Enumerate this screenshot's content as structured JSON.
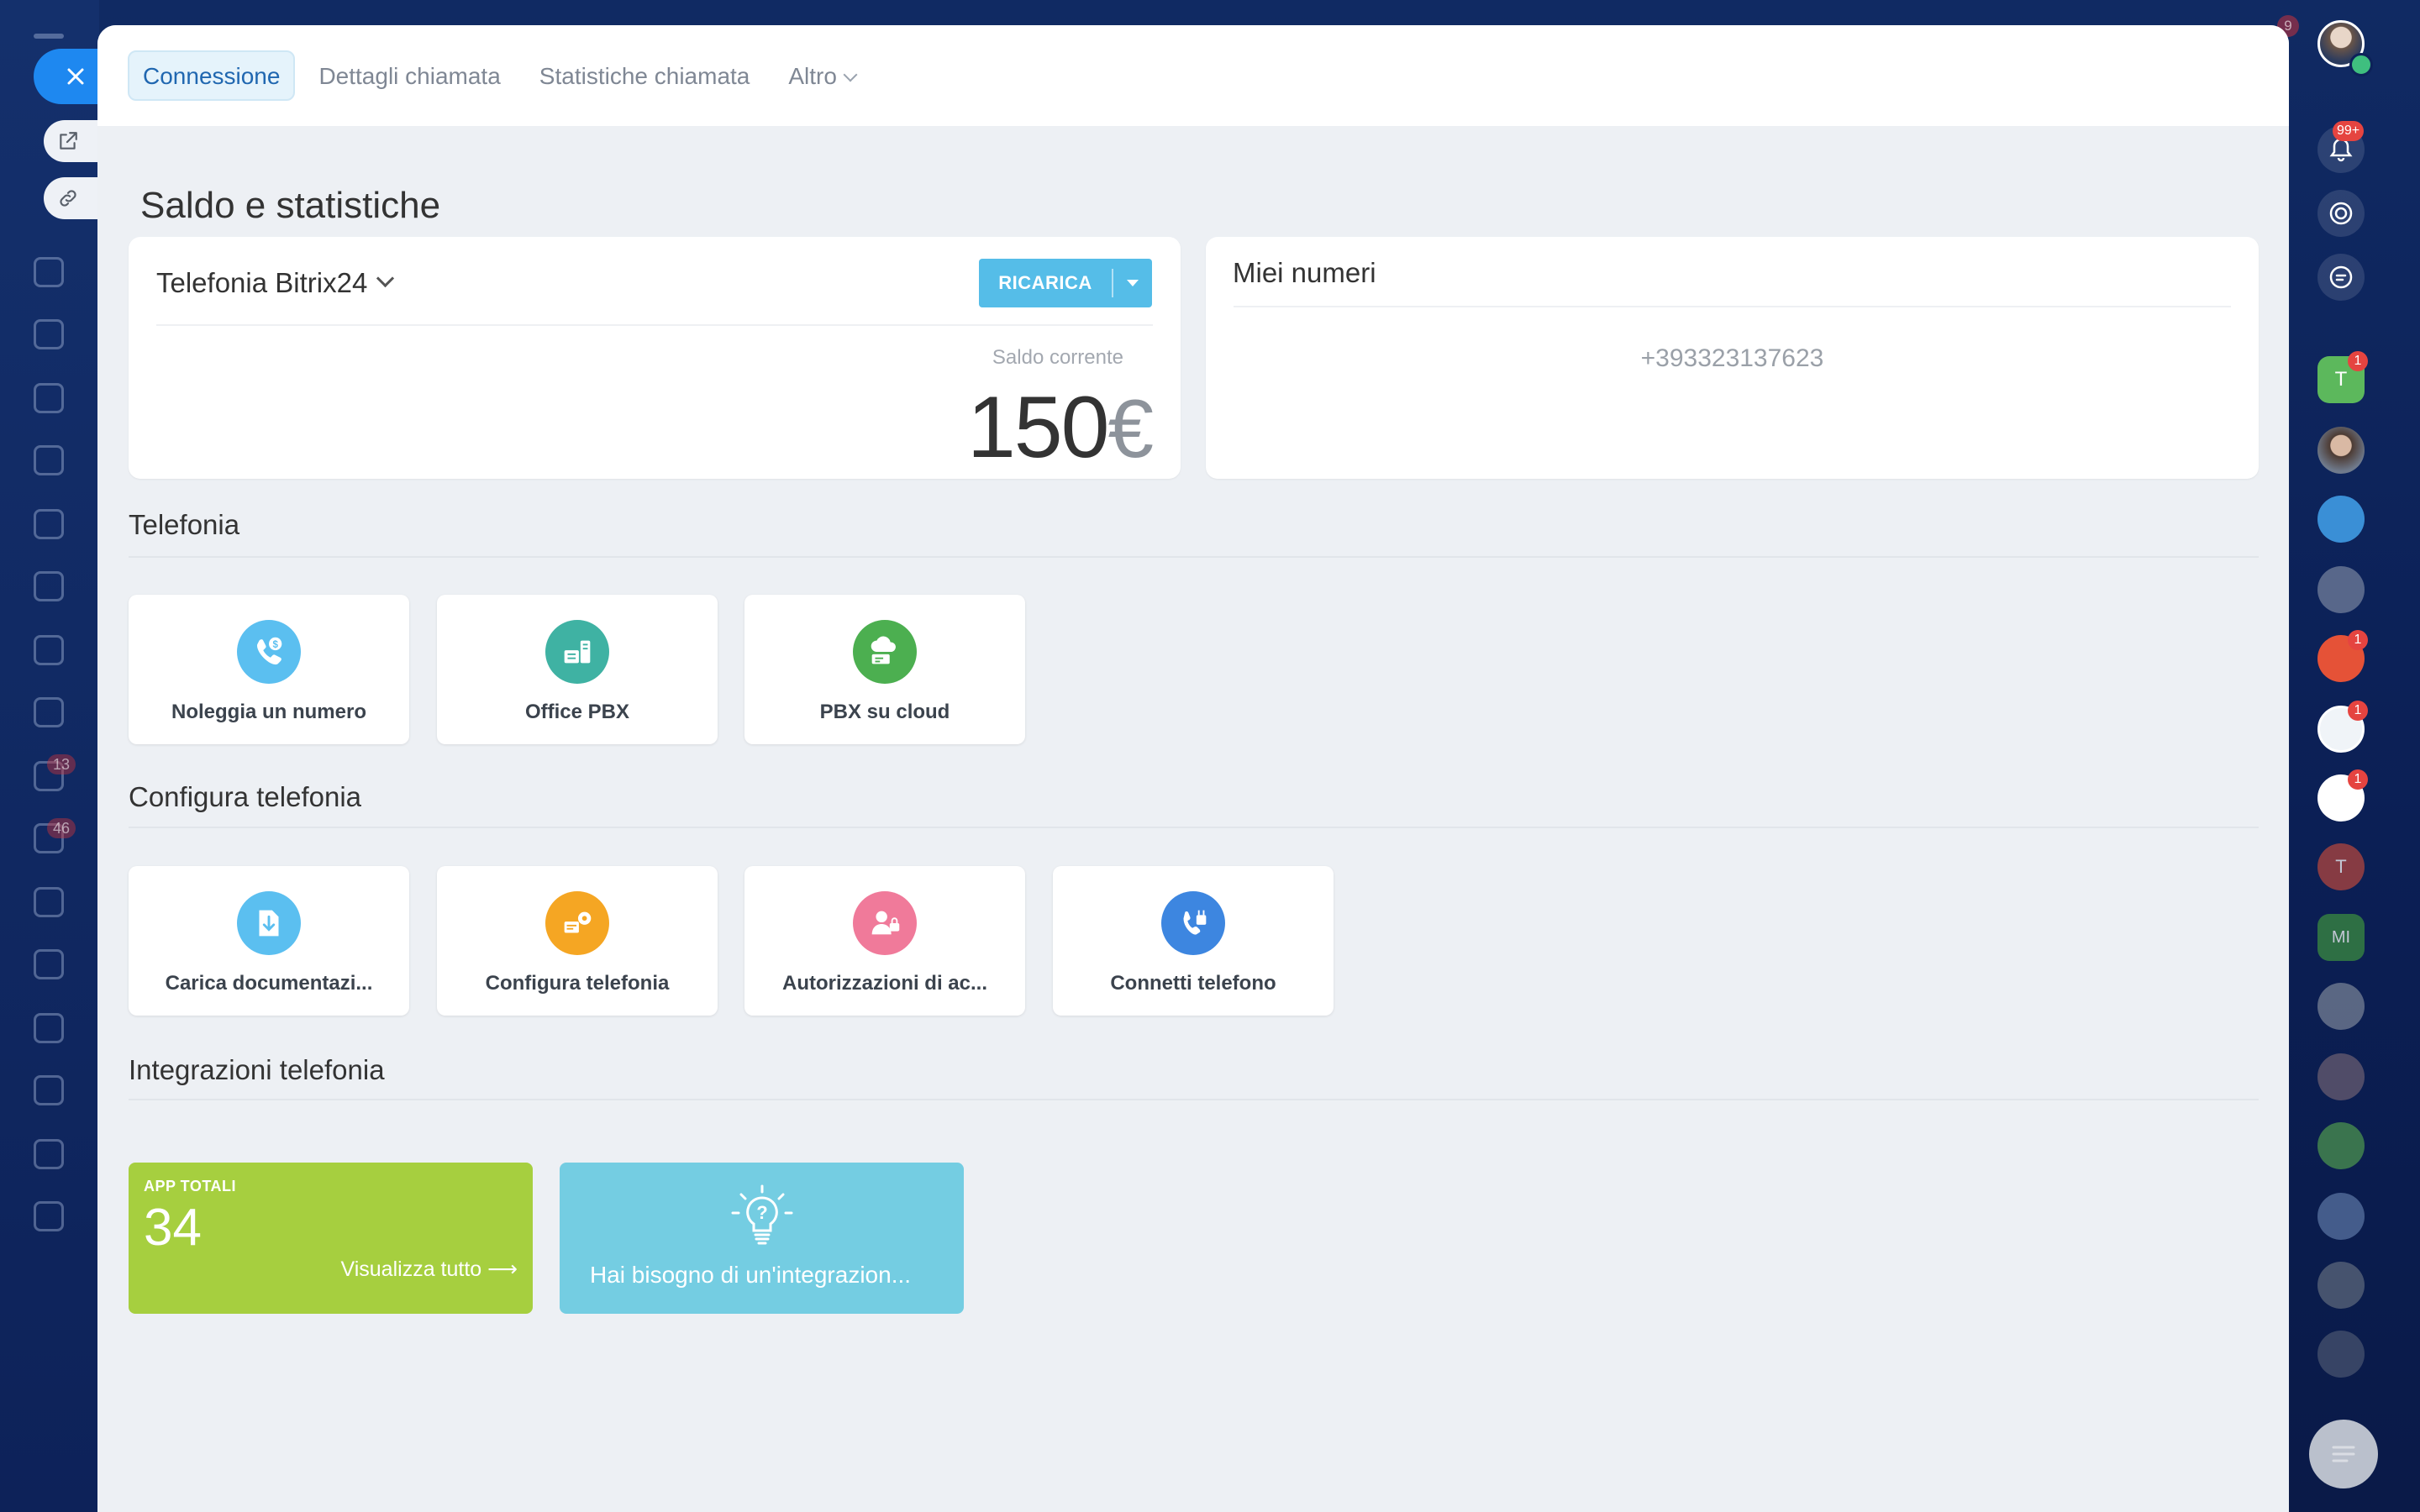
{
  "app": {
    "title": "Saldo e statistiche"
  },
  "tabs": [
    {
      "label": "Connessione",
      "active": true
    },
    {
      "label": "Dettagli chiamata"
    },
    {
      "label": "Statistiche chiamata"
    },
    {
      "label": "Altro"
    }
  ],
  "balance": {
    "provider": "Telefonia Bitrix24",
    "recharge_label": "RICARICA",
    "label": "Saldo corrente",
    "amount": "150",
    "currency": "€"
  },
  "numbers": {
    "title": "Miei numeri",
    "items": [
      "+393323137623"
    ]
  },
  "sections": {
    "telephony": {
      "title": "Telefonia",
      "tiles": [
        {
          "label": "Noleggia un numero",
          "icon": "phone-dollar-icon",
          "color": "#5bbff0"
        },
        {
          "label": "Office PBX",
          "icon": "office-pbx-icon",
          "color": "#3fb2a3"
        },
        {
          "label": "PBX su cloud",
          "icon": "cloud-pbx-icon",
          "color": "#4caf50"
        }
      ]
    },
    "configure": {
      "title": "Configura telefonia",
      "tiles": [
        {
          "label": "Carica documentazi...",
          "icon": "document-download-icon",
          "color": "#5bbff0"
        },
        {
          "label": "Configura telefonia",
          "icon": "settings-telephony-icon",
          "color": "#f5a623"
        },
        {
          "label": "Autorizzazioni di ac...",
          "icon": "user-lock-icon",
          "color": "#f07a9a"
        },
        {
          "label": "Connetti telefono",
          "icon": "phone-plug-icon",
          "color": "#3d86e0"
        }
      ]
    },
    "integrations": {
      "title": "Integrazioni telefonia",
      "apps_caption": "APP TOTALI",
      "apps_count": "34",
      "view_all": "Visualizza tutto",
      "need_integration": "Hai bisogno di un'integrazion..."
    }
  },
  "right_bar": {
    "notifications_badge": "99+",
    "avatar_badges": [
      "1",
      "1",
      "1",
      "1"
    ]
  },
  "background": {
    "left_badges": [
      "13",
      "46"
    ],
    "top_badge": "9"
  },
  "colors": {
    "accent": "#1e88f0",
    "recharge": "#55bde8",
    "apps_card": "#a6cf3f",
    "help_card": "#74cde2",
    "badge": "#e54440"
  }
}
